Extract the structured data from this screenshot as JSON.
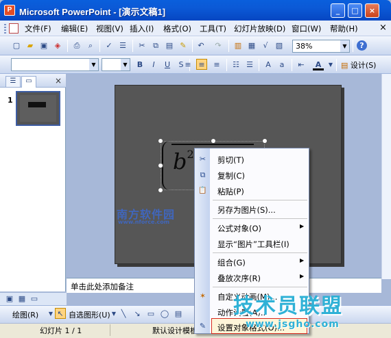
{
  "window": {
    "title": "Microsoft PowerPoint - [演示文稿1]",
    "app_icon_letter": "P",
    "minimize": "_",
    "maximize": "□",
    "close": "×"
  },
  "menu": {
    "items": [
      "文件(F)",
      "编辑(E)",
      "视图(V)",
      "插入(I)",
      "格式(O)",
      "工具(T)",
      "幻灯片放映(D)",
      "窗口(W)",
      "帮助(H)"
    ],
    "close_doc": "×"
  },
  "toolbar": {
    "zoom": "38%",
    "design_label": "设计(S)",
    "help_icon": "?"
  },
  "left_pane": {
    "slide_number": "1",
    "tab_outline_icon": "outline-icon",
    "tab_slides_icon": "slides-icon",
    "close": "×"
  },
  "slide": {
    "equation_base": "b",
    "equation_exponent": "2"
  },
  "notes": {
    "placeholder": "单击此处添加备注"
  },
  "drawing_toolbar": {
    "draw_label": "绘图(R)",
    "autoshapes_label": "自选图形(U)"
  },
  "status": {
    "slide_info": "幻灯片 1 / 1",
    "design": "默认设计模板"
  },
  "context_menu": {
    "items": [
      {
        "label": "剪切(T)",
        "icon": "cut-icon",
        "glyph": "✂",
        "submenu": false
      },
      {
        "label": "复制(C)",
        "icon": "copy-icon",
        "glyph": "⧉",
        "submenu": false
      },
      {
        "label": "粘贴(P)",
        "icon": "paste-icon",
        "glyph": "📋",
        "submenu": false
      },
      {
        "label": "另存为图片(S)...",
        "icon": "",
        "glyph": "",
        "submenu": false
      },
      {
        "label": "公式对象(O)",
        "icon": "",
        "glyph": "",
        "submenu": true
      },
      {
        "label": "显示“图片”工具栏(I)",
        "icon": "",
        "glyph": "",
        "submenu": false
      },
      {
        "label": "组合(G)",
        "icon": "",
        "glyph": "",
        "submenu": true
      },
      {
        "label": "叠放次序(R)",
        "icon": "",
        "glyph": "",
        "submenu": true
      },
      {
        "label": "自定义动画(M)...",
        "icon": "animation-icon",
        "glyph": "✶",
        "submenu": false
      },
      {
        "label": "动作设置(A)...",
        "icon": "",
        "glyph": "",
        "submenu": false
      },
      {
        "label": "设置对象格式(O)...",
        "icon": "format-object-icon",
        "glyph": "✎",
        "submenu": false
      }
    ],
    "submenu_arrow": "▶"
  },
  "watermarks": {
    "left_main": "南方软件园",
    "left_sub": "www.nforce.com",
    "right_main": "技术员联盟",
    "right_sub": "www.jsgho.com"
  }
}
